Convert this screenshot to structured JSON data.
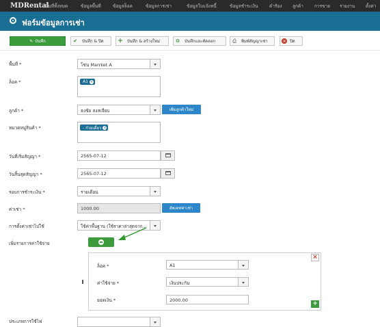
{
  "nav": {
    "brand": "MDRental",
    "items": [
      "พื้นที่ทั้งหมด",
      "ข้อมูลพื้นที่",
      "ข้อมูลล็อค",
      "ข้อมูลการเช่า",
      "ข้อมูลใบแจ้งหนี้",
      "ข้อมูลชำระเงิน",
      "คำร้อง",
      "ลูกค้า",
      "การขาย",
      "รายงาน",
      "ตั้งค่า"
    ]
  },
  "header": {
    "title": "ฟอร์มข้อมูลการเช่า"
  },
  "toolbar": {
    "save": "บันทึก",
    "save_close": "บันทึก & ปิด",
    "save_new": "บันทึก & สร้างใหม่",
    "save_copy": "บันทึกและคัดลอก",
    "print": "พิมพ์สัญญาเช่า",
    "close": "ปิด"
  },
  "form": {
    "area_label": "พื้นที่ *",
    "area_value": "โซน Marrket A",
    "lock_label": "ล็อค *",
    "lock_tag": "A1",
    "customer_label": "ลูกค้า *",
    "customer_value": "ธงชัย สงสเจียบ",
    "add_customer": "เพิ่มลูกค้าใหม่",
    "category_label": "หมวดหมู่สินค้า *",
    "category_tag": "- ก๋วยเตี๋ยว",
    "start_label": "วันที่เริ่มสัญญา *",
    "start_value": "2565-07-12",
    "end_label": "วันสิ้นสุดสัญญา *",
    "end_value": "2565-07-12",
    "cycle_label": "รอบการชำระเงิน *",
    "cycle_value": "รายเดือน",
    "rent_label": "ค่าเช่า *",
    "rent_value": "1000.00",
    "update_rent": "อัพเดทค่าเช่า",
    "rent_setting_label": "การตั้งค่าเช่าไปใช้",
    "rent_setting_value": "ใช้ค่าพื้นฐาน (ใช้ราคาล่าสุดจาก...",
    "add_expense_label": "เพิ่มรายการค่าใช้จ่าย",
    "bottom_label": "ประเภทการใช้ไฟ"
  },
  "expense": {
    "lock_label": "ล็อค *",
    "lock_value": "A1",
    "type_label": "ค่าใช้จ่าย *",
    "type_value": "เงินประกัน",
    "amount_label": "ยอดเงิน *",
    "amount_value": "2000.00"
  },
  "colors": {
    "header": "#1b6e93",
    "green": "#3c9b3c",
    "blue": "#2c86c9",
    "arrow": "#2e9a2e"
  }
}
